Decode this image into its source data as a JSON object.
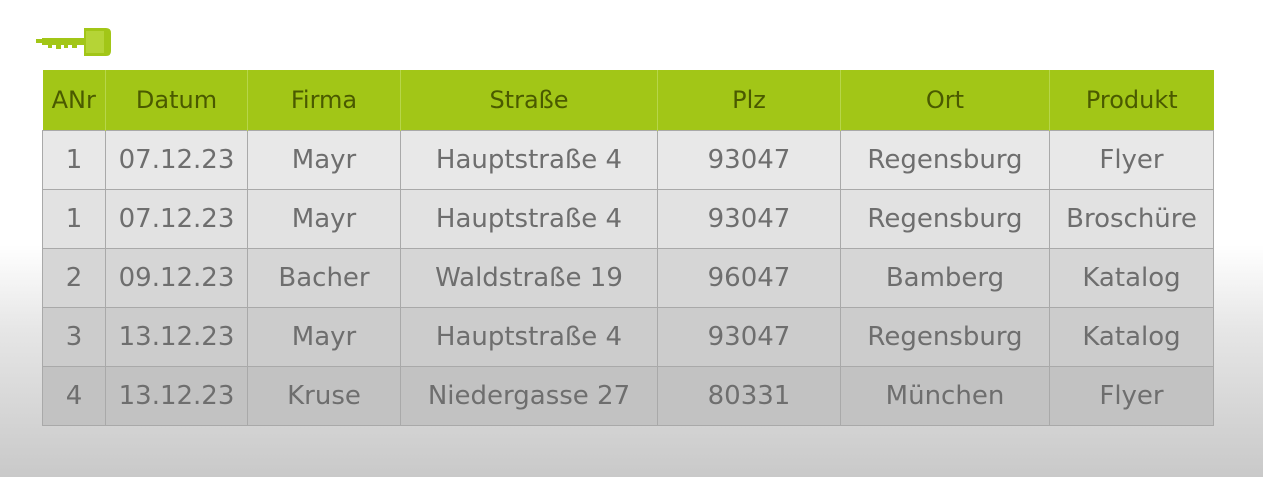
{
  "colors": {
    "accent": "#a2c617",
    "header_text": "#4a5a00",
    "cell_text": "#6e6e6e"
  },
  "icon": "key-icon",
  "table": {
    "headers": [
      "ANr",
      "Datum",
      "Firma",
      "Straße",
      "Plz",
      "Ort",
      "Produkt"
    ],
    "rows": [
      [
        "1",
        "07.12.23",
        "Mayr",
        "Hauptstraße 4",
        "93047",
        "Regensburg",
        "Flyer"
      ],
      [
        "1",
        "07.12.23",
        "Mayr",
        "Hauptstraße 4",
        "93047",
        "Regensburg",
        "Broschüre"
      ],
      [
        "2",
        "09.12.23",
        "Bacher",
        "Waldstraße 19",
        "96047",
        "Bamberg",
        "Katalog"
      ],
      [
        "3",
        "13.12.23",
        "Mayr",
        "Hauptstraße 4",
        "93047",
        "Regensburg",
        "Katalog"
      ],
      [
        "4",
        "13.12.23",
        "Kruse",
        "Niedergasse 27",
        "80331",
        "München",
        "Flyer"
      ]
    ]
  }
}
